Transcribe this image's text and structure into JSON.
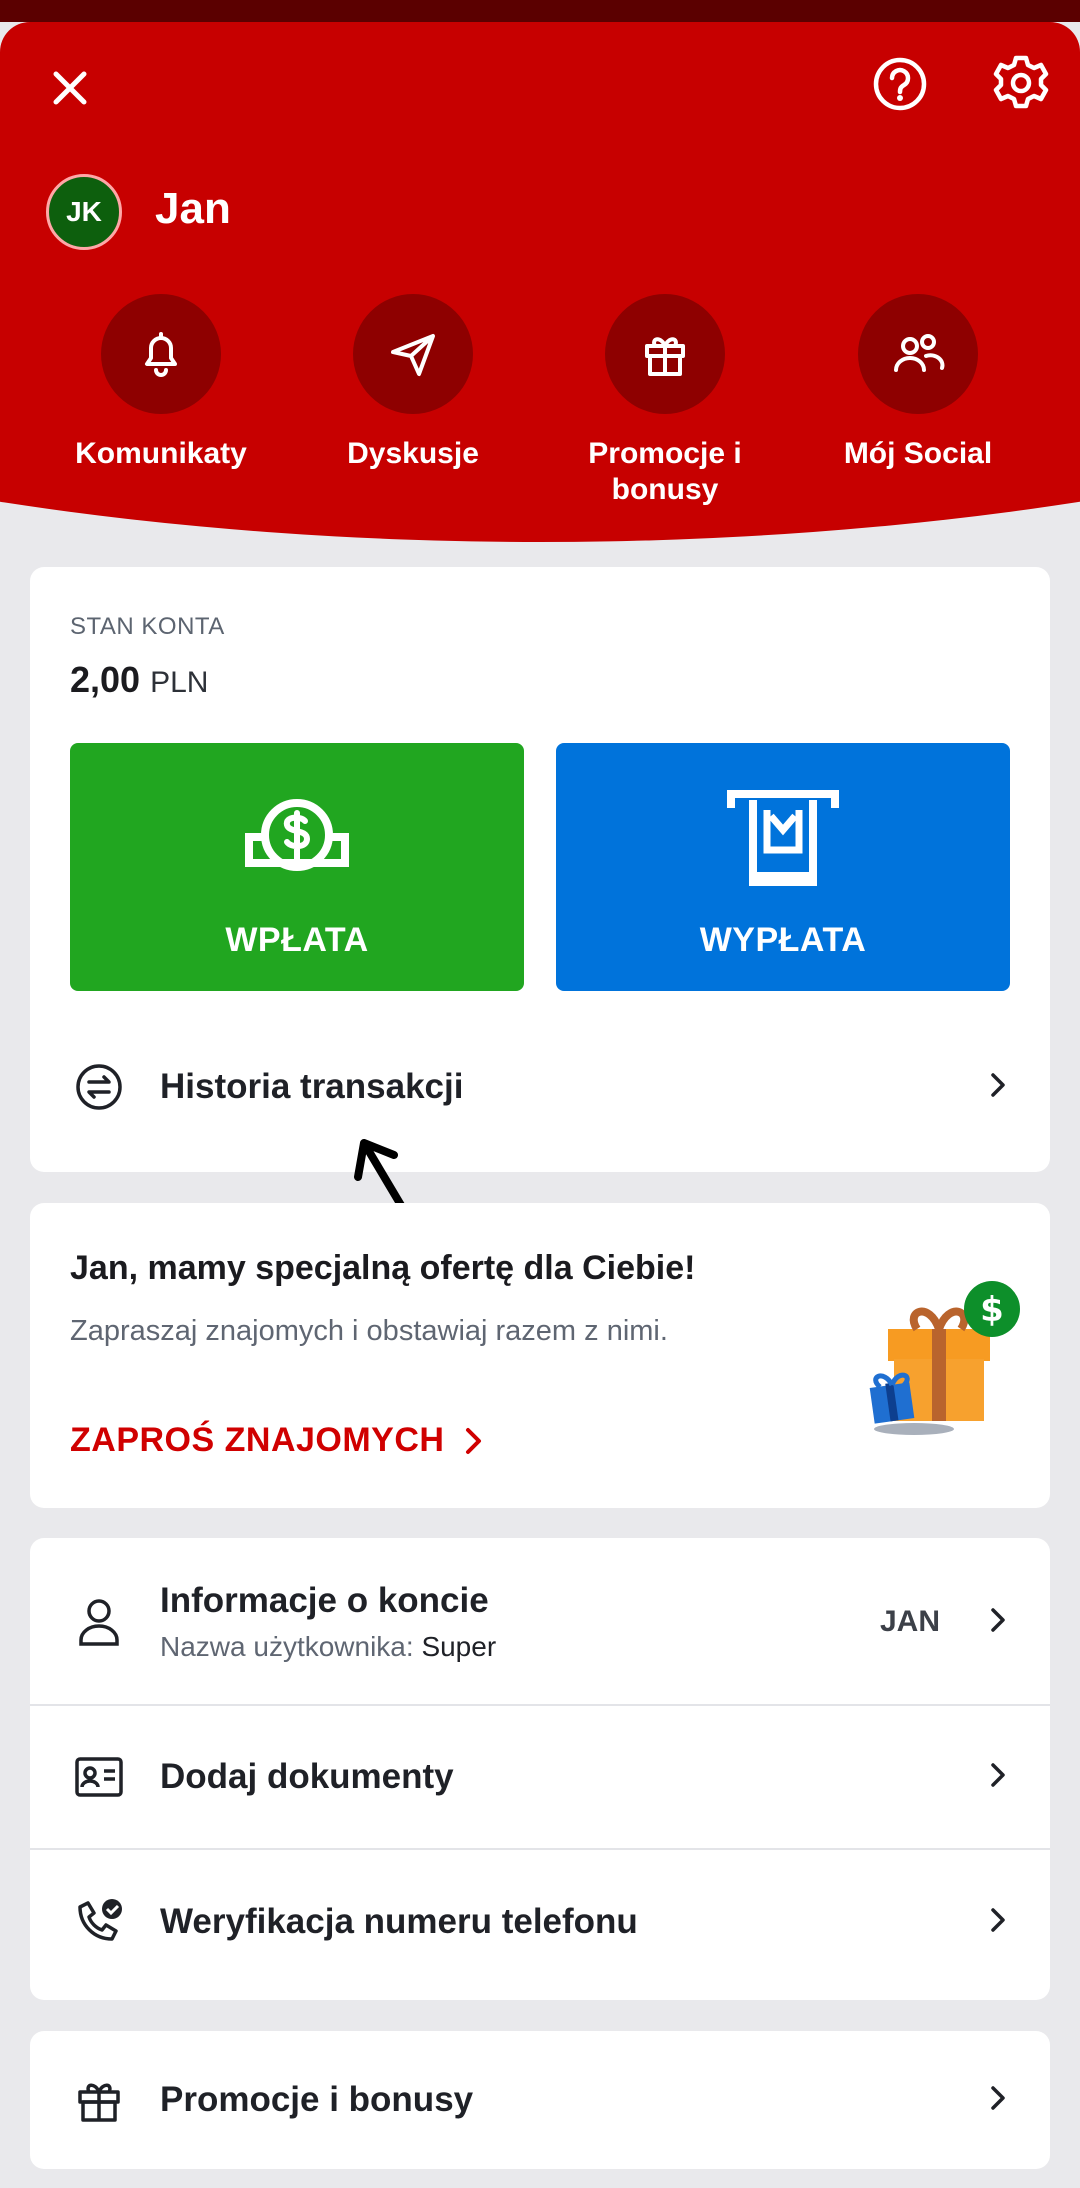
{
  "header": {
    "close_icon": "close-icon",
    "help_icon": "help-icon",
    "settings_icon": "gear-icon",
    "avatar_initials": "JK",
    "username": "Jan",
    "actions": [
      {
        "label": "Komunikaty",
        "icon": "bell-icon"
      },
      {
        "label": "Dyskusje",
        "icon": "send-icon"
      },
      {
        "label": "Promocje i bonusy",
        "icon": "gift-icon"
      },
      {
        "label": "Mój Social",
        "icon": "people-icon"
      }
    ]
  },
  "balance": {
    "label": "STAN KONTA",
    "amount": "2,00",
    "currency": "PLN",
    "deposit_label": "WPŁATA",
    "withdraw_label": "WYPŁATA",
    "history_label": "Historia transakcji"
  },
  "promo": {
    "title": "Jan, mamy specjalną ofertę dla Ciebie!",
    "subtitle": "Zapraszaj znajomych i obstawiaj razem z nimi.",
    "cta": "ZAPROŚ ZNAJOMYCH"
  },
  "account": {
    "info_title": "Informacje o koncie",
    "username_label": "Nazwa użytkownika:",
    "username_value": "Super",
    "right_value": "JAN",
    "documents": "Dodaj dokumenty",
    "phone_verification": "Weryfikacja numeru telefonu"
  },
  "promotions": {
    "label": "Promocje i bonusy"
  },
  "colors": {
    "brand_red": "#c70000",
    "deposit_green": "#21a620",
    "withdraw_blue": "#0073db"
  }
}
